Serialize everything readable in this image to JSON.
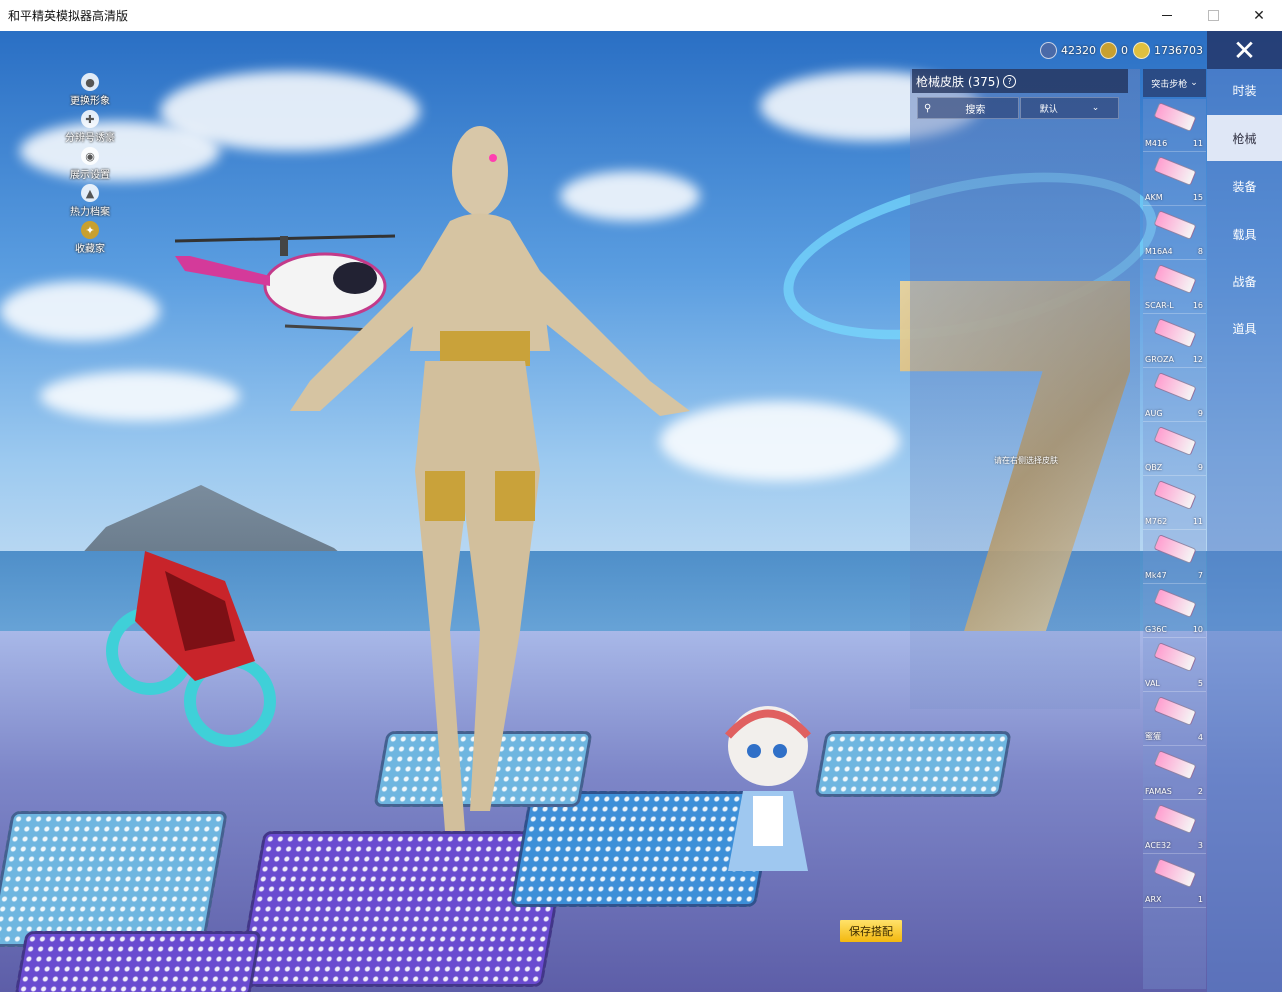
{
  "window": {
    "title": "和平精英模拟器高清版",
    "close_glyph": "✕"
  },
  "left_menu": [
    {
      "label": "更换形象",
      "icon": "person-icon"
    },
    {
      "label": "分辨号诱豪",
      "icon": "gamepad-icon"
    },
    {
      "label": "展示设置",
      "icon": "eye-icon"
    },
    {
      "label": "热力档案",
      "icon": "fire-icon"
    },
    {
      "label": "收藏家",
      "icon": "collector-icon"
    }
  ],
  "currency": [
    {
      "value": "42320",
      "color": "#4a6aa8"
    },
    {
      "value": "0",
      "color": "#c8a030"
    },
    {
      "value": "1736703",
      "color": "#e0c040"
    }
  ],
  "categories": [
    {
      "label": "时装",
      "active": false
    },
    {
      "label": "枪械",
      "active": true
    },
    {
      "label": "装备",
      "active": false
    },
    {
      "label": "载具",
      "active": false
    },
    {
      "label": "战备",
      "active": false
    },
    {
      "label": "道具",
      "active": false
    }
  ],
  "skin_panel": {
    "title": "枪械皮肤 (375)",
    "help_glyph": "?",
    "search_placeholder": "搜索",
    "sort_label": "默认",
    "weapon_type": "突击步枪"
  },
  "weapons": [
    {
      "name": "M416",
      "count": "11"
    },
    {
      "name": "AKM",
      "count": "15"
    },
    {
      "name": "M16A4",
      "count": "8"
    },
    {
      "name": "SCAR-L",
      "count": "16"
    },
    {
      "name": "GROZA",
      "count": "12"
    },
    {
      "name": "AUG",
      "count": "9"
    },
    {
      "name": "QBZ",
      "count": "9"
    },
    {
      "name": "M762",
      "count": "11"
    },
    {
      "name": "Mk47",
      "count": "7"
    },
    {
      "name": "G36C",
      "count": "10"
    },
    {
      "name": "VAL",
      "count": "5"
    },
    {
      "name": "蜜獾",
      "count": "4"
    },
    {
      "name": "FAMAS",
      "count": "2"
    },
    {
      "name": "ACE32",
      "count": "3"
    },
    {
      "name": "ARX",
      "count": "1"
    }
  ],
  "scene_hint": "请在右侧选择皮肤",
  "save_label": "保存搭配"
}
